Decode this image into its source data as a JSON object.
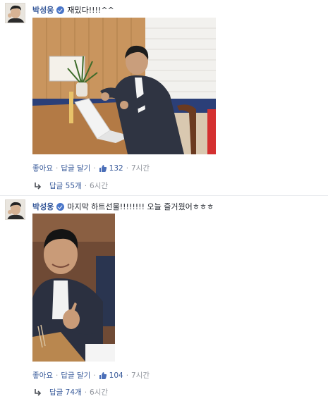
{
  "comments": [
    {
      "author": "박성웅",
      "text": "재밌다!!!!^^",
      "actions": {
        "like": "좋아요",
        "reply": "답글 달기",
        "like_count": "132",
        "time": "7시간"
      },
      "replies": {
        "label": "답글 55개",
        "time": "6시간"
      }
    },
    {
      "author": "박성웅",
      "text": "마지막 하트선물!!!!!!!! 오늘 즐거웠어ㅎㅎㅎ",
      "actions": {
        "like": "좋아요",
        "reply": "답글 달기",
        "like_count": "104",
        "time": "7시간"
      },
      "replies": {
        "label": "답글 74개",
        "time": "6시간"
      }
    }
  ],
  "icons": {
    "verified": "verified-badge-icon",
    "like": "thumbs-up-icon",
    "reply": "reply-arrow-icon"
  },
  "colors": {
    "link": "#365899",
    "muted": "#90949c",
    "text": "#1d2129",
    "badge": "#4a76c9"
  }
}
